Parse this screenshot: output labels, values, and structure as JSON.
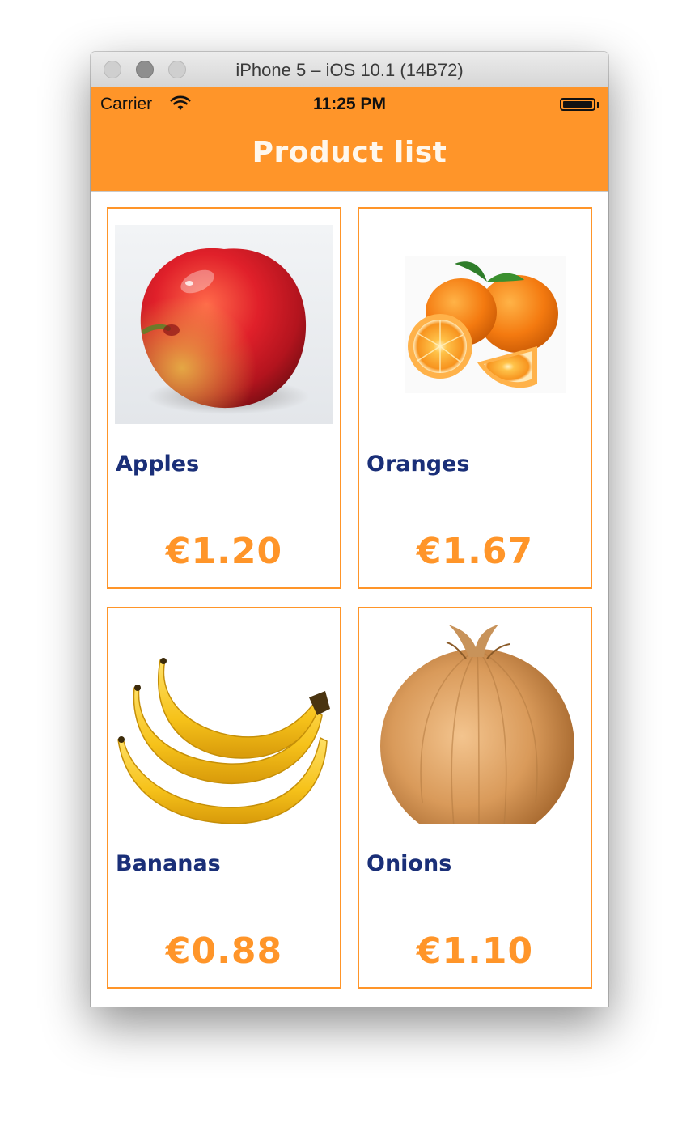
{
  "window": {
    "title": "iPhone 5 – iOS 10.1 (14B72)"
  },
  "status_bar": {
    "carrier": "Carrier",
    "time": "11:25 PM",
    "wifi_icon": "wifi-icon",
    "battery_icon": "battery-icon"
  },
  "nav": {
    "title": "Product list"
  },
  "colors": {
    "accent": "#ff9529",
    "product_name": "#1a2f78",
    "background": "#ffffff"
  },
  "products": [
    {
      "name": "Apples",
      "price": "€1.20",
      "image": "apple-image"
    },
    {
      "name": "Oranges",
      "price": "€1.67",
      "image": "oranges-image"
    },
    {
      "name": "Bananas",
      "price": "€0.88",
      "image": "bananas-image"
    },
    {
      "name": "Onions",
      "price": "€1.10",
      "image": "onion-image"
    }
  ]
}
